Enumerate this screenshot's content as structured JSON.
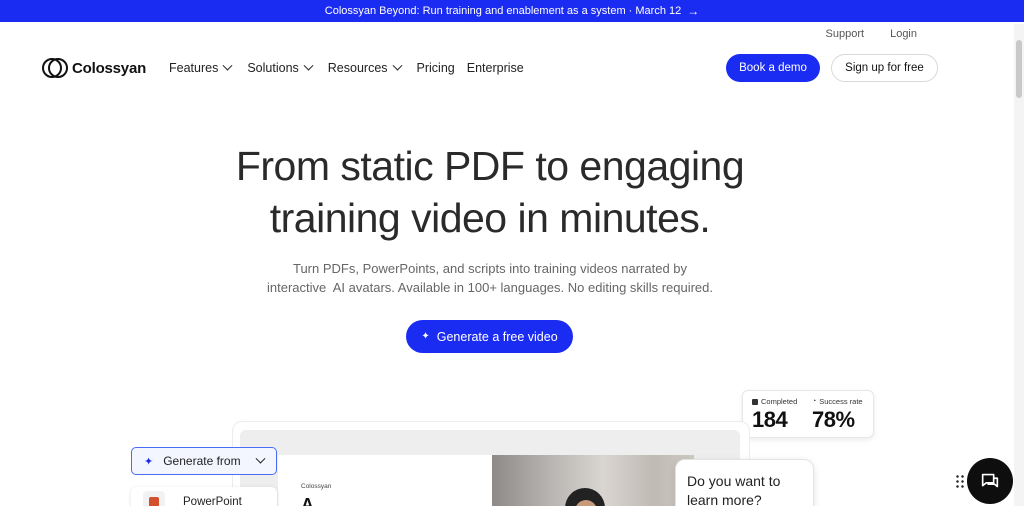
{
  "banner": {
    "text": "Colossyan Beyond: Run training and enablement as a system · March 12",
    "arrow": "→"
  },
  "util_links": {
    "support": "Support",
    "login": "Login"
  },
  "logo": {
    "text": "Colossyan",
    "icon": "colossyan-logo-icon"
  },
  "nav": {
    "features": "Features",
    "solutions": "Solutions",
    "resources": "Resources",
    "pricing": "Pricing",
    "enterprise": "Enterprise"
  },
  "header_buttons": {
    "demo": "Book a demo",
    "signup": "Sign up for free"
  },
  "hero": {
    "title_line1": "From static PDF to engaging",
    "title_line2": "training video in minutes.",
    "sub_line1": "Turn PDFs, PowerPoints, and scripts into training videos narrated by",
    "sub_line2": "interactive  AI avatars. Available in 100+ languages. No editing skills required.",
    "cta": "Generate a free video",
    "cta_icon": "sparkle-icon"
  },
  "stats": {
    "completed_label": "Completed",
    "completed_value": "184",
    "success_label": "Success rate",
    "success_value": "78%"
  },
  "preview": {
    "brand": "Colossyan",
    "heading": "A...."
  },
  "generate_from": {
    "label": "Generate from",
    "option": "PowerPoint"
  },
  "chat": {
    "bubble": "Do you want to learn more?"
  },
  "colors": {
    "accent": "#1b2cf2",
    "banner_bg": "#1b2cf2",
    "text": "#2a2a2a"
  }
}
